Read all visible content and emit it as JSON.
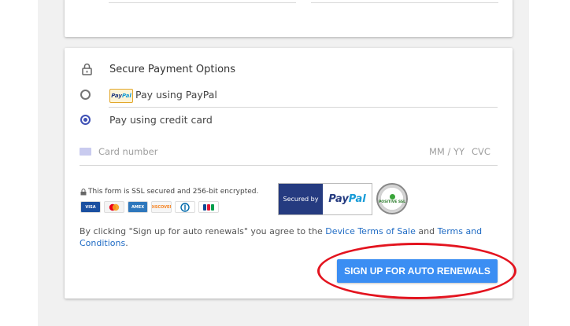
{
  "payment": {
    "title": "Secure Payment Options",
    "paypal_chip_part1": "Pay",
    "paypal_chip_part2": "Pal",
    "option_paypal": "Pay using PayPal",
    "option_card": "Pay using credit card",
    "selected_option": "credit card",
    "card_number_placeholder": "Card number",
    "expiry_placeholder": "MM / YY",
    "cvc_placeholder": "CVC",
    "ssl_text": "This form is SSL secured and 256-bit encrypted.",
    "card_logos": [
      "VISA",
      "MC",
      "AMEX",
      "DISCOVER",
      "DINERS",
      "JCB"
    ],
    "secured_badge_left": "Secured by",
    "secured_badge_pay": "Pay",
    "secured_badge_pal": "Pal",
    "ssl_seal_text": "POSITIVE SSL",
    "terms_prefix": "By clicking \"Sign up for auto renewals\" you agree to the ",
    "terms_link1": "Device Terms of Sale",
    "terms_and": " and ",
    "terms_link2": "Terms and Conditions",
    "terms_suffix": ".",
    "signup_button": "SIGN UP FOR AUTO RENEWALS"
  },
  "colors": {
    "button": "#3b8ef3",
    "link": "#1f6bc4",
    "radio_selected": "#3f51b5",
    "annotation": "#e3141f"
  }
}
